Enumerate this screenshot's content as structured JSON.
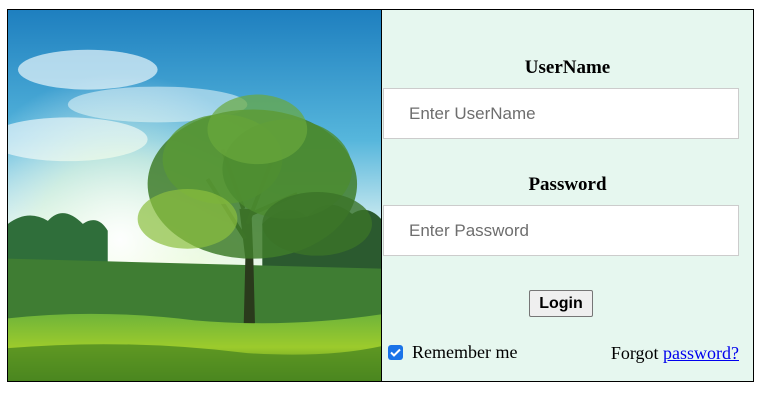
{
  "login_form": {
    "username_label": "UserName",
    "username_placeholder": "Enter UserName",
    "username_value": "",
    "password_label": "Password",
    "password_placeholder": "Enter Password",
    "password_value": "",
    "login_button_label": "Login",
    "remember_label": "Remember me",
    "remember_checked": true,
    "forgot_text": "Forgot",
    "forgot_link_label": "password?"
  },
  "colors": {
    "form_background": "#e6f7ef",
    "link": "#0000ee",
    "checkbox_accent": "#1a73e8"
  },
  "hero_image": {
    "subject": "tree-in-sunlit-meadow"
  }
}
